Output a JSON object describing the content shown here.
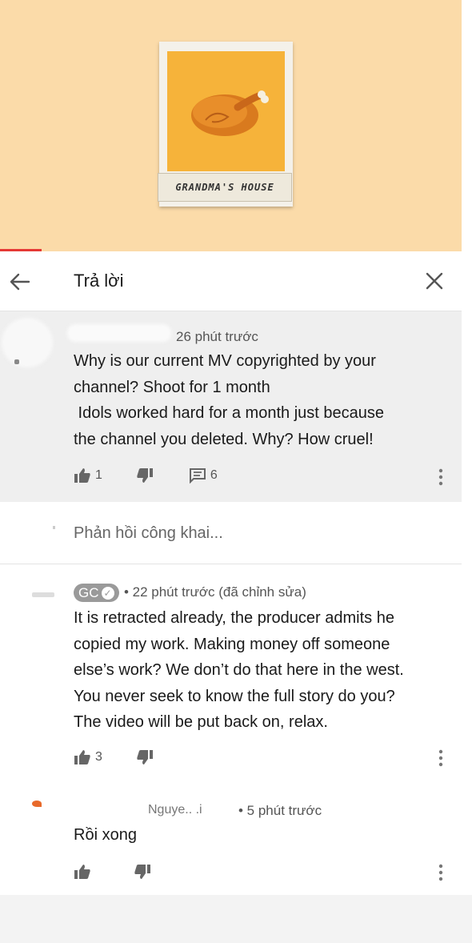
{
  "video": {
    "caption": "GRANDMA'S HOUSE",
    "background_color": "#fbdba9",
    "photo_color": "#f6b33a",
    "progress_color": "#e53935"
  },
  "header": {
    "title": "Trả lời",
    "back_icon": "arrow-left-icon",
    "close_icon": "close-icon"
  },
  "parent_comment": {
    "timestamp": "26 phút trước",
    "lines": [
      "Why is our current MV copyrighted by your",
      "channel? Shoot for 1 month",
      " Idols worked hard for a month just because",
      "the channel you deleted. Why? How cruel!"
    ],
    "likes": "1",
    "replies": "6"
  },
  "reply_box": {
    "placeholder": "Phản hồi công khai..."
  },
  "replies": [
    {
      "author": "GC",
      "meta": "• 22 phút trước (đã chỉnh sửa)",
      "lines": [
        "It is retracted already, the producer admits he",
        "copied my work. Making money off someone",
        "else’s work? We don’t do that here in the west.",
        "You never seek to know the full story do you?",
        "The video will be put back on, relax."
      ],
      "likes": "3"
    },
    {
      "author_partial": "Nguye.. .i",
      "meta": "• 5 phút trước",
      "lines": [
        "Rồi xong"
      ],
      "likes": ""
    }
  ]
}
